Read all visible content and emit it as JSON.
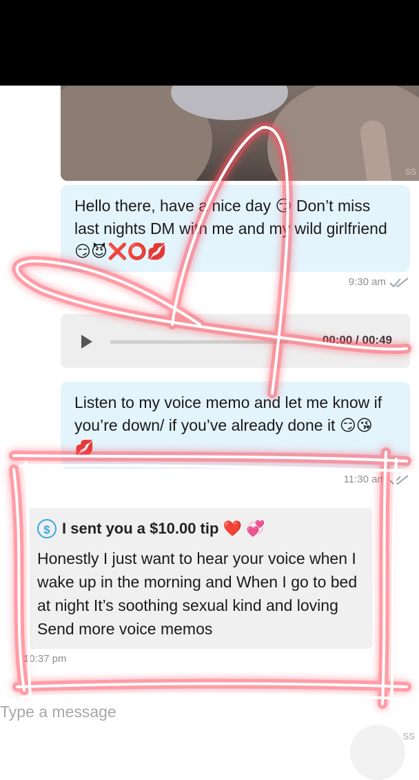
{
  "thread": {
    "msg1": {
      "text": "Hello there, have a nice day 😏 Don’t miss last nights DM with me and my wild girlfriend 😏😈❌⭕💋",
      "time": "9:30 am"
    },
    "audio": {
      "time": "00:00 / 00:49"
    },
    "msg2": {
      "text": "Listen to my voice memo and let me know if you’re down/ if you’ve already done it 😏😘💋",
      "time": "11:30 am"
    },
    "tip": {
      "icon_symbol": "$",
      "label": "I sent you a $10.00 tip ❤️ 💞",
      "message": "Honestly I just want to hear your voice when I wake up in the morning and When I go to bed at night It’s soothing sexual kind and loving Send more voice memos",
      "time": "10:37 pm"
    }
  },
  "composer": {
    "placeholder": "Type a message"
  },
  "watermarks": {
    "photo": "SS",
    "bottom": "SS"
  },
  "colors": {
    "outgoing_bubble": "#e3f4fc",
    "tip_card": "#f0f0f0",
    "read_ticks": "#9aa3ab",
    "annotation_glow": "#ff4d5e",
    "tip_icon": "#3aa7e4"
  },
  "icons": [
    "play-icon",
    "read-ticks-icon",
    "dollar-coin-icon"
  ]
}
